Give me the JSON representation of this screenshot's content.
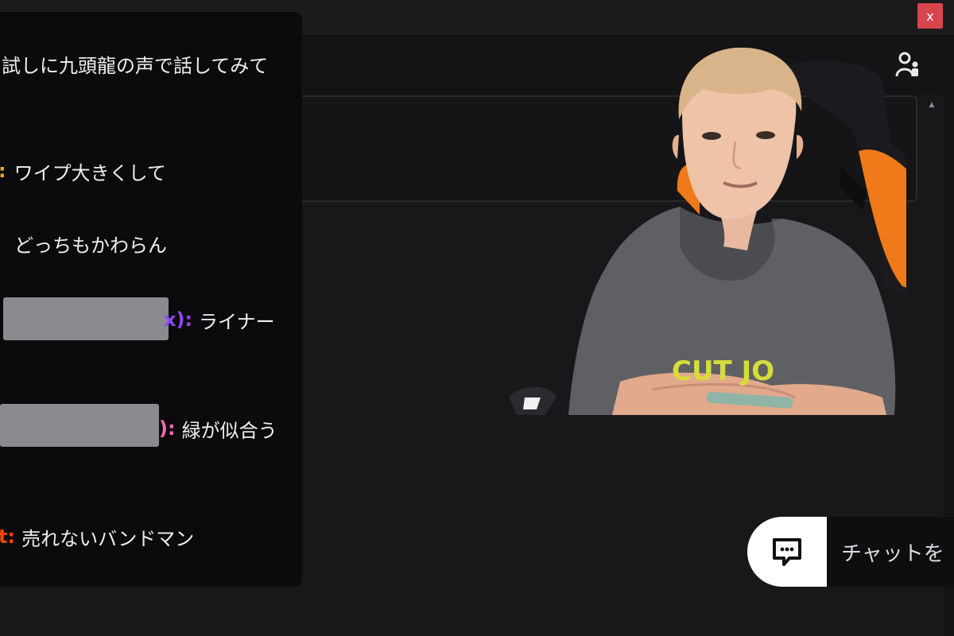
{
  "window": {
    "close_label": "x"
  },
  "chat": {
    "messages": [
      {
        "user": "",
        "text": "試しに九頭龍の声で話してみて",
        "user_color": "#efeff1",
        "redacted": false
      },
      {
        "user": ":",
        "text": "ワイプ大きくして",
        "user_color": "#f5a623",
        "redacted": false
      },
      {
        "user": "",
        "text": "どっちもかわらん",
        "user_color": "#efeff1",
        "redacted": false
      },
      {
        "user": "x):",
        "text": "ライナー",
        "user_color": "#9147ff",
        "redacted": true
      },
      {
        "user": "):",
        "text": "緑が似合う",
        "user_color": "#ff69b4",
        "redacted": true
      },
      {
        "user": "t:",
        "text": "売れないバンドマン",
        "user_color": "#ff4500",
        "redacted": false
      }
    ]
  },
  "webcam": {
    "shirt_text": "CUT JO"
  },
  "chat_button": {
    "label": "チャットを",
    "icon": "chat-bubble-icon"
  },
  "icons": {
    "participants": "participants-icon",
    "scroll_up": "scroll-up-icon",
    "close": "close-icon"
  },
  "colors": {
    "background": "#18181b",
    "close": "#d9454d",
    "pill": "#ffffff"
  }
}
